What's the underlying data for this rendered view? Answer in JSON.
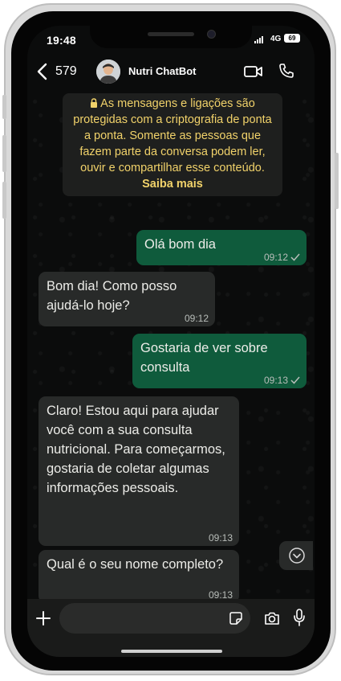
{
  "status_bar": {
    "time": "19:48",
    "network": "4G",
    "battery": "69"
  },
  "header": {
    "back_count": "579",
    "contact_name": "Nutri ChatBot"
  },
  "encryption_notice": {
    "text": "As mensagens e ligações são protegidas com a criptografia de ponta a ponta. Somente as pessoas que fazem parte da conversa podem ler, ouvir e compartilhar esse conteúdo.",
    "link": "Saiba mais"
  },
  "messages": [
    {
      "direction": "out",
      "text": "Olá bom dia",
      "time": "09:12",
      "read": true
    },
    {
      "direction": "in",
      "text": "Bom dia! Como posso ajudá-lo hoje?",
      "time": "09:12"
    },
    {
      "direction": "out",
      "text": "Gostaria de ver sobre consulta",
      "time": "09:13",
      "read": true
    },
    {
      "direction": "in",
      "text": "Claro! Estou aqui para ajudar você com a sua consulta nutricional. Para começarmos, gostaria de coletar algumas informações pessoais.",
      "time": "09:13"
    },
    {
      "direction": "in",
      "text": "Qual é o seu nome completo?",
      "time": "09:13"
    }
  ],
  "input": {
    "placeholder": ""
  },
  "colors": {
    "outgoing_bubble": "#0f5b3c",
    "incoming_bubble": "#282a29",
    "notice_text": "#f1d26a",
    "background": "#0b0c0c"
  }
}
